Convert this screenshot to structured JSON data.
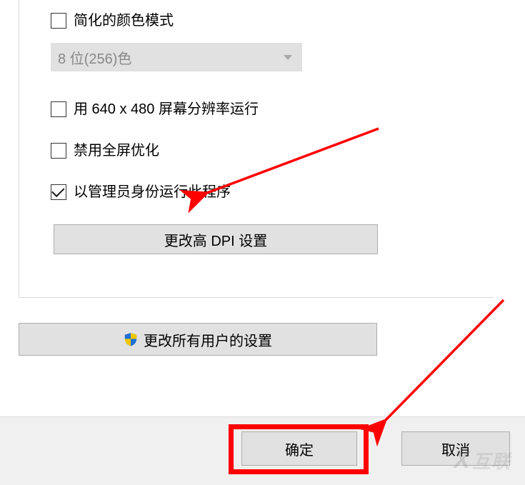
{
  "settings": {
    "reduced_color_label": "简化的颜色模式",
    "reduced_color_checked": false,
    "color_mode_selected": "8 位(256)色",
    "low_res_label": "用 640 x 480 屏幕分辨率运行",
    "low_res_checked": false,
    "disable_fullscreen_opt_label": "禁用全屏优化",
    "disable_fullscreen_opt_checked": false,
    "run_as_admin_label": "以管理员身份运行此程序",
    "run_as_admin_checked": true,
    "dpi_button_label": "更改高 DPI 设置",
    "all_users_button_label": "更改所有用户的设置"
  },
  "footer": {
    "ok_label": "确定",
    "cancel_label": "取消"
  },
  "annotation": {
    "highlight_target": "ok-button",
    "arrow1_points_to": "run-as-admin-checkbox-row",
    "arrow2_points_to": "ok-button",
    "color": "#ff0000"
  },
  "watermark": "互联"
}
